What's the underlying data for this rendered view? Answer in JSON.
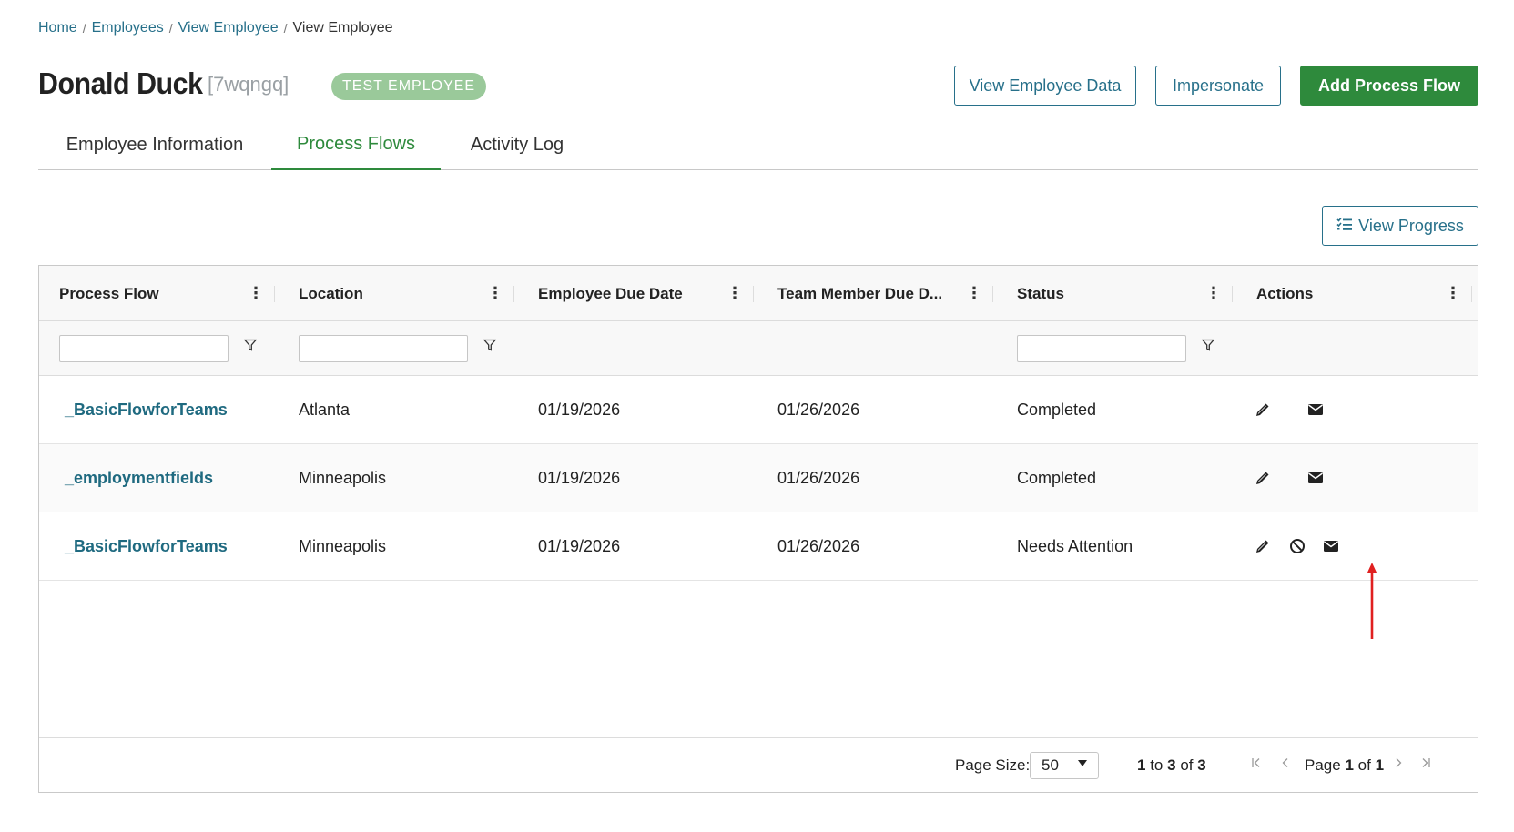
{
  "breadcrumb": {
    "items": [
      "Home",
      "Employees",
      "View Employee"
    ],
    "separator": "/",
    "current": "View Employee"
  },
  "employee": {
    "name": "Donald Duck",
    "code": "[7wqngq]",
    "badge": "TEST EMPLOYEE"
  },
  "header_buttons": {
    "view_data": "View Employee Data",
    "impersonate": "Impersonate",
    "add_flow": "Add Process Flow"
  },
  "tabs": [
    {
      "label": "Employee Information",
      "active": false
    },
    {
      "label": "Process Flows",
      "active": true
    },
    {
      "label": "Activity Log",
      "active": false
    }
  ],
  "view_progress": {
    "label": "View Progress",
    "icon": "list-check-icon"
  },
  "grid": {
    "columns": [
      "Process Flow",
      "Location",
      "Employee Due Date",
      "Team Member Due D...",
      "Status",
      "Actions"
    ],
    "rows": [
      {
        "process_flow": "_BasicFlowforTeams",
        "location": "Atlanta",
        "employee_due": "01/19/2026",
        "team_due": "01/26/2026",
        "status": "Completed",
        "actions": [
          "edit",
          "email"
        ]
      },
      {
        "process_flow": "_employmentfields",
        "location": "Minneapolis",
        "employee_due": "01/19/2026",
        "team_due": "01/26/2026",
        "status": "Completed",
        "actions": [
          "edit",
          "email"
        ]
      },
      {
        "process_flow": "_BasicFlowforTeams",
        "location": "Minneapolis",
        "employee_due": "01/19/2026",
        "team_due": "01/26/2026",
        "status": "Needs Attention",
        "actions": [
          "edit",
          "cancel",
          "email"
        ]
      }
    ],
    "footer": {
      "page_size_label": "Page Size:",
      "page_size": "50",
      "range_from": "1",
      "range_to_word": "to",
      "range_to": "3",
      "range_of_word": "of",
      "range_total": "3",
      "page_word": "Page",
      "page_current": "1",
      "page_of_word": "of",
      "page_total": "1"
    }
  },
  "colors": {
    "link": "#27708a",
    "green": "#2e8a3c",
    "badge": "#9ac99a",
    "annotation_arrow": "#e02020"
  }
}
